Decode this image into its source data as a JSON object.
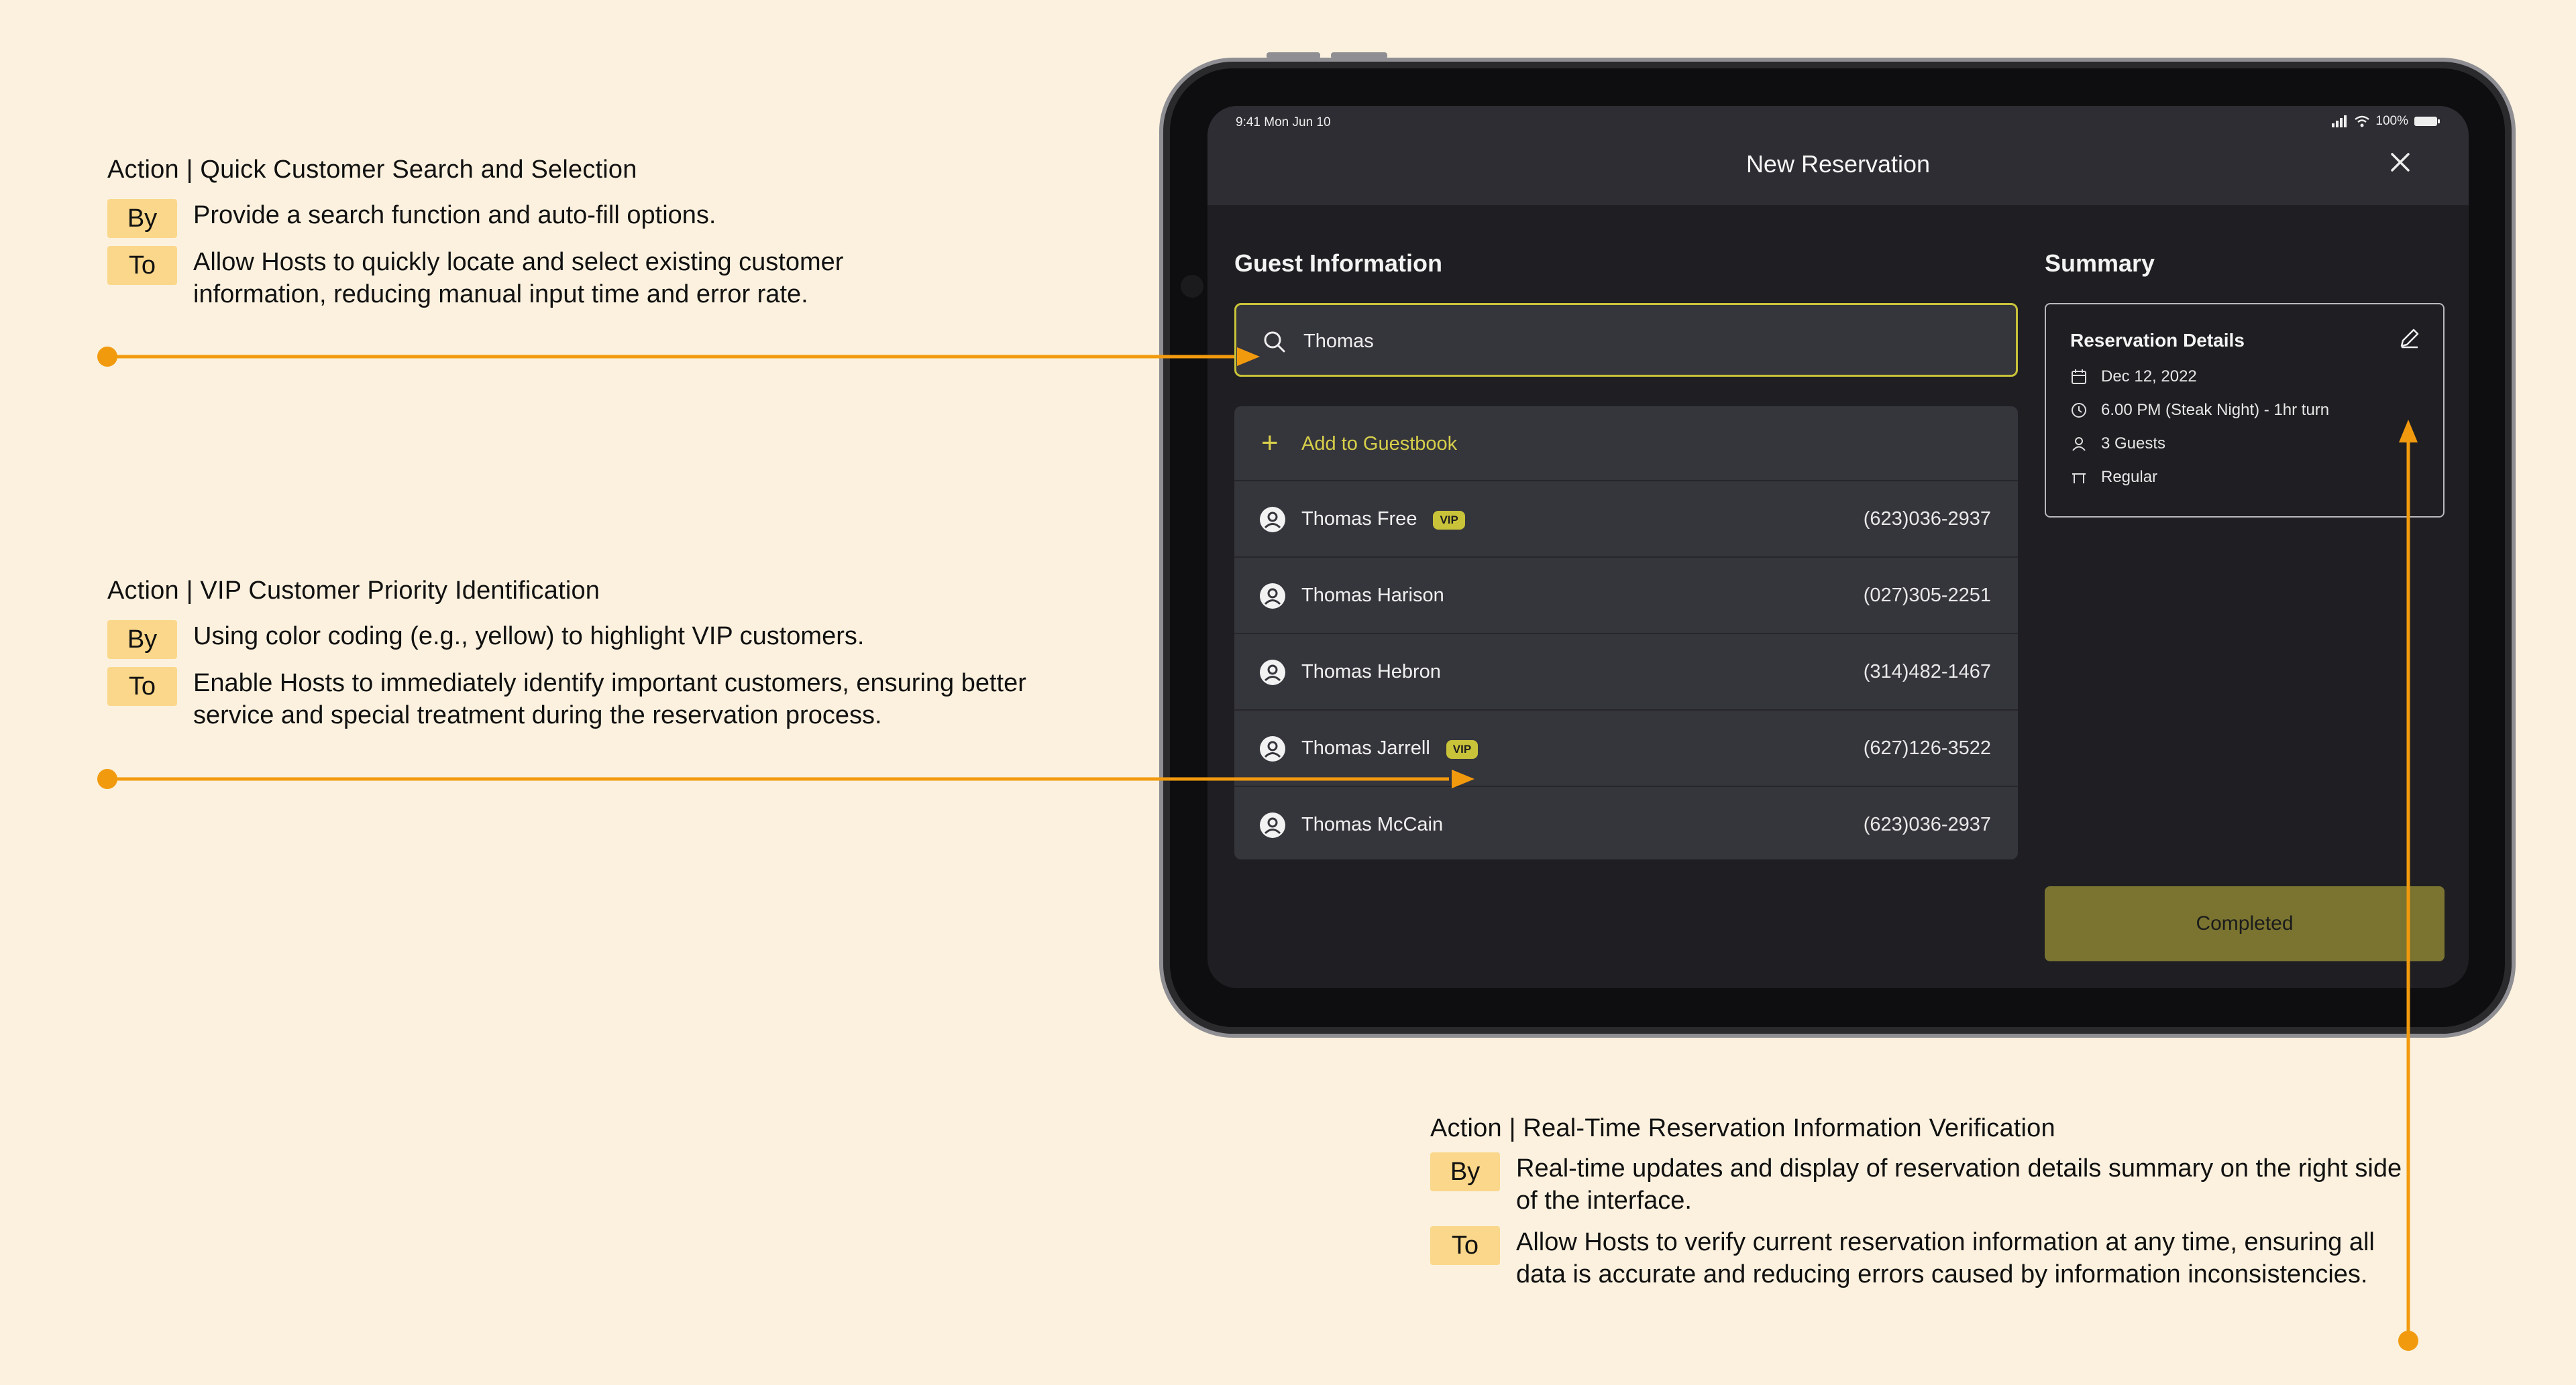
{
  "annotations": [
    {
      "title": "Action | Quick Customer Search and Selection",
      "by_tag": "By",
      "by_text": "Provide a search function and auto-fill options.",
      "to_tag": "To",
      "to_text": "Allow Hosts to quickly locate and select existing customer information, reducing manual input time and error rate."
    },
    {
      "title": "Action | VIP Customer Priority Identification",
      "by_tag": "By",
      "by_text": "Using color coding (e.g., yellow) to highlight VIP customers.",
      "to_tag": "To",
      "to_text": "Enable Hosts to immediately identify important customers, ensuring better service and special treatment during the reservation process."
    },
    {
      "title": "Action | Real-Time Reservation Information Verification",
      "by_tag": "By",
      "by_text": "Real-time updates and display of reservation details summary on the right side of the interface.",
      "to_tag": "To",
      "to_text": "Allow Hosts to verify current reservation information at any time, ensuring all data is accurate and reducing errors caused by information inconsistencies."
    }
  ],
  "status_bar": {
    "time": "9:41  Mon Jun 10",
    "battery": "100%"
  },
  "header": {
    "title": "New Reservation",
    "close_icon": "close-icon"
  },
  "guest_info": {
    "title": "Guest Information",
    "search_value": "Thomas",
    "add_label": "Add to Guestbook",
    "guests": [
      {
        "name": "Thomas Free",
        "vip": "VIP",
        "phone": "(623)036-2937"
      },
      {
        "name": "Thomas Harison",
        "vip": "",
        "phone": "(027)305-2251"
      },
      {
        "name": "Thomas Hebron",
        "vip": "",
        "phone": "(314)482-1467"
      },
      {
        "name": "Thomas Jarrell",
        "vip": "VIP",
        "phone": "(627)126-3522"
      },
      {
        "name": "Thomas McCain",
        "vip": "",
        "phone": "(623)036-2937"
      }
    ]
  },
  "summary": {
    "title": "Summary",
    "details_title": "Reservation Details",
    "date": "Dec 12, 2022",
    "time": "6.00 PM (Steak Night) - 1hr turn",
    "guests": "3 Guests",
    "table_type": "Regular",
    "completed_label": "Completed"
  },
  "colors": {
    "background": "#FBF1DE",
    "tag": "#FAD78A",
    "accent_orange": "#F29A0E",
    "vip_yellow": "#C9C33A",
    "completed_button": "#7A7430"
  }
}
